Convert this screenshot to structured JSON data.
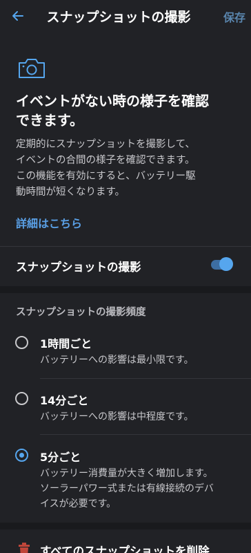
{
  "header": {
    "title": "スナップショットの撮影",
    "save_label": "保存"
  },
  "intro": {
    "heading_line1": "イベントがない時の様子を確認",
    "heading_line2": "できます。",
    "desc_lines": [
      "定期的にスナップショットを撮影して、",
      "イベントの合間の様子を確認できます。",
      "この機能を有効にすると、バッテリー駆",
      "動時間が短くなります。"
    ],
    "link": "詳細はこちら"
  },
  "toggle": {
    "label": "スナップショットの撮影",
    "enabled": true
  },
  "frequency": {
    "section_title": "スナップショットの撮影頻度",
    "options": [
      {
        "title": "1時間ごと",
        "desc_lines": [
          "バッテリーへの影響は最小限です。"
        ],
        "selected": false
      },
      {
        "title": "14分ごと",
        "desc_lines": [
          "バッテリーへの影響は中程度です。"
        ],
        "selected": false
      },
      {
        "title": "5分ごと",
        "desc_lines": [
          "バッテリー消費量が大きく増加します。",
          "ソーラーパワー式または有線接続のデバ",
          "イスが必要です。"
        ],
        "selected": true
      }
    ]
  },
  "delete": {
    "label": "すべてのスナップショットを削除",
    "icon_color": "#c0463a"
  },
  "colors": {
    "background": "#212226",
    "accent": "#56a6ee",
    "save": "#5a86ae",
    "link": "#5aa0e6"
  }
}
